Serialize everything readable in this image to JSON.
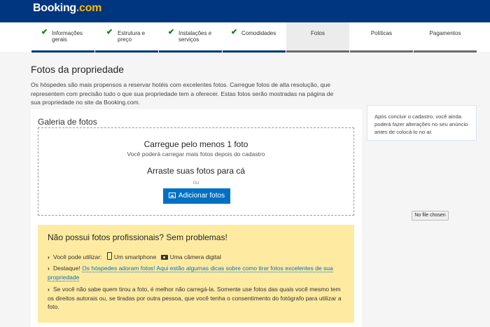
{
  "header": {
    "logo_main": "Booking",
    "logo_suffix": ".com",
    "bg_color": "#003580",
    "accent_color": "#febb02"
  },
  "steps": [
    {
      "line1": "Informações",
      "line2": "gerais",
      "status": "done",
      "icon": "checkmark-icon"
    },
    {
      "line1": "Estrutura e",
      "line2": "preço",
      "status": "done",
      "icon": "checkmark-icon"
    },
    {
      "line1": "Instalações e",
      "line2": "serviços",
      "status": "done",
      "icon": "checkmark-icon"
    },
    {
      "line1": "Comodidades",
      "line2": "",
      "status": "done",
      "icon": "checkmark-icon"
    },
    {
      "line1": "Fotos",
      "line2": "",
      "status": "active"
    },
    {
      "line1": "Políticas",
      "line2": "",
      "status": "todo"
    },
    {
      "line1": "Pagamentos",
      "line2": "",
      "status": "todo"
    }
  ],
  "page": {
    "title": "Fotos da propriedade",
    "description": "Os hóspedes são mais propensos a reservar hotéis com excelentes fotos. Carregue fotos de alta resolução, que representem com precisão tudo o que sua propriedade tem a oferecer. Estas fotos serão mostradas na página de sua propriedade no site da Booking.com."
  },
  "gallery": {
    "title": "Galeria de fotos",
    "upload_min": "Carregue pelo menos 1 foto",
    "upload_more": "Você poderá carregar mais fotos depois do cadastro",
    "drag_text": "Arraste suas fotos para cá",
    "or_text": "ou",
    "add_button": "Adicionar fotos",
    "button_color": "#0071c2"
  },
  "tips": {
    "title": "Não possui fotos profissionais? Sem problemas!",
    "use_label": "Você pode utilizar:",
    "smartphone": "Um smartphone",
    "camera": "Uma câmera digital",
    "highlight_label": "Destaque!",
    "highlight_link": "Os hóspedes adoram fotos! Aqui estão algumas dicas sobre como tirar fotos excelentes de sua propriedade",
    "rights_text": "Se você não sabe quem tirou a foto, é melhor não carregá-la. Somente use fotos das quais você mesmo tem os direitos autorais ou, se tiradas por outra pessoa, que você tenha o consentimento do fotógrafo para utilizar a foto.",
    "bg_color": "#feeba1"
  },
  "sidebar": {
    "note": "Após concluir o cadastro, você ainda poderá fazer alterações no seu anúncio antes de colocá-lo no ar."
  },
  "file_input": {
    "label": "No file chosen"
  }
}
